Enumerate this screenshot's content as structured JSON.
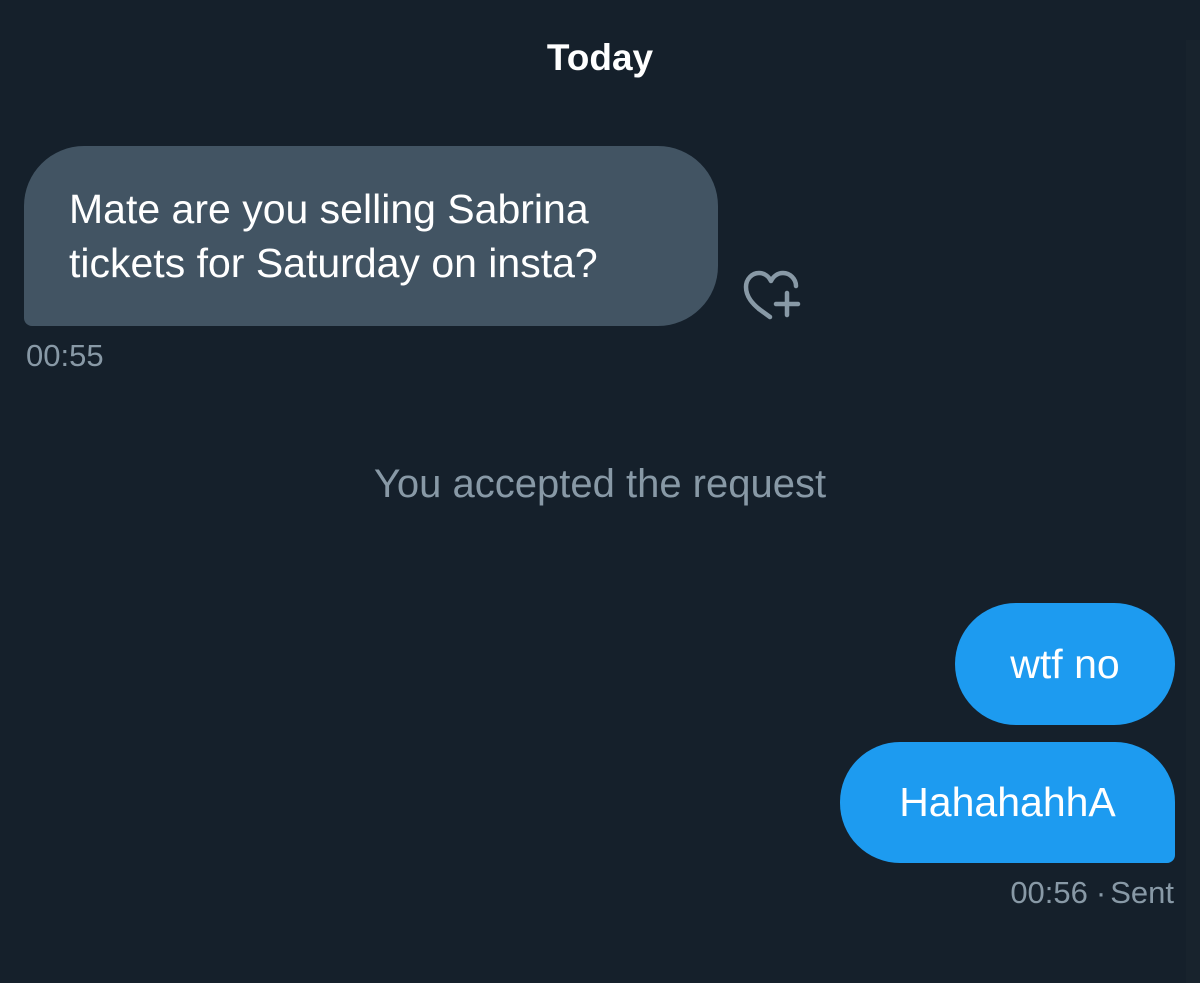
{
  "conversation": {
    "day_separator": "Today",
    "messages": [
      {
        "direction": "received",
        "text": "Mate are you selling Sabrina tickets for Saturday on insta?",
        "time": "00:55"
      },
      {
        "direction": "sent",
        "text": "wtf no"
      },
      {
        "direction": "sent",
        "text": "HahahahhA",
        "time": "00:56",
        "status": "Sent"
      }
    ],
    "system_message": "You accepted the request",
    "react_icon": "heart-plus-icon",
    "separator_glyph": "·"
  },
  "colors": {
    "background": "#15202b",
    "received_bubble": "#425463",
    "sent_bubble": "#1d9bf0",
    "muted_text": "#8899a6"
  }
}
